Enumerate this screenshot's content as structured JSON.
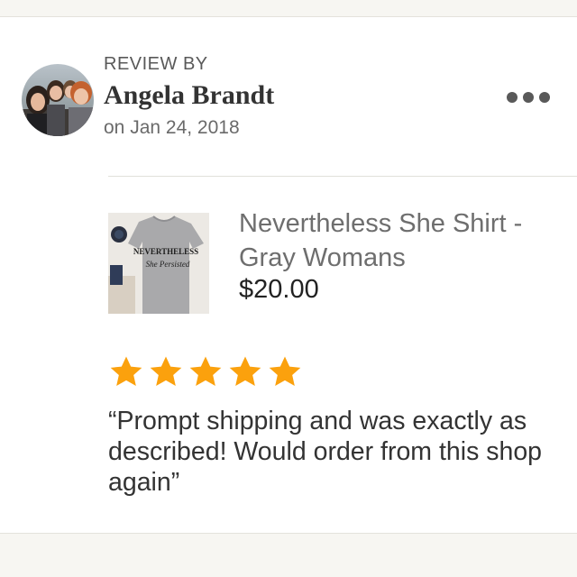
{
  "review": {
    "heading": "REVIEW BY",
    "reviewer_name": "Angela Brandt",
    "date": "on Jan 24, 2018",
    "more_label": "●●●",
    "rating": 5,
    "rating_max": 5,
    "star_color": "#fba10d",
    "text": "“Prompt shipping and was exactly as described!  Would order from this shop again”"
  },
  "product": {
    "title": "Nevertheless She Shirt - Gray Womans",
    "price": "$20.00",
    "shirt_print": "NEVERTHELESS She Persisted"
  },
  "icons": {
    "avatar": "reviewer-photo",
    "more": "more-options-icon",
    "star": "star-icon"
  }
}
